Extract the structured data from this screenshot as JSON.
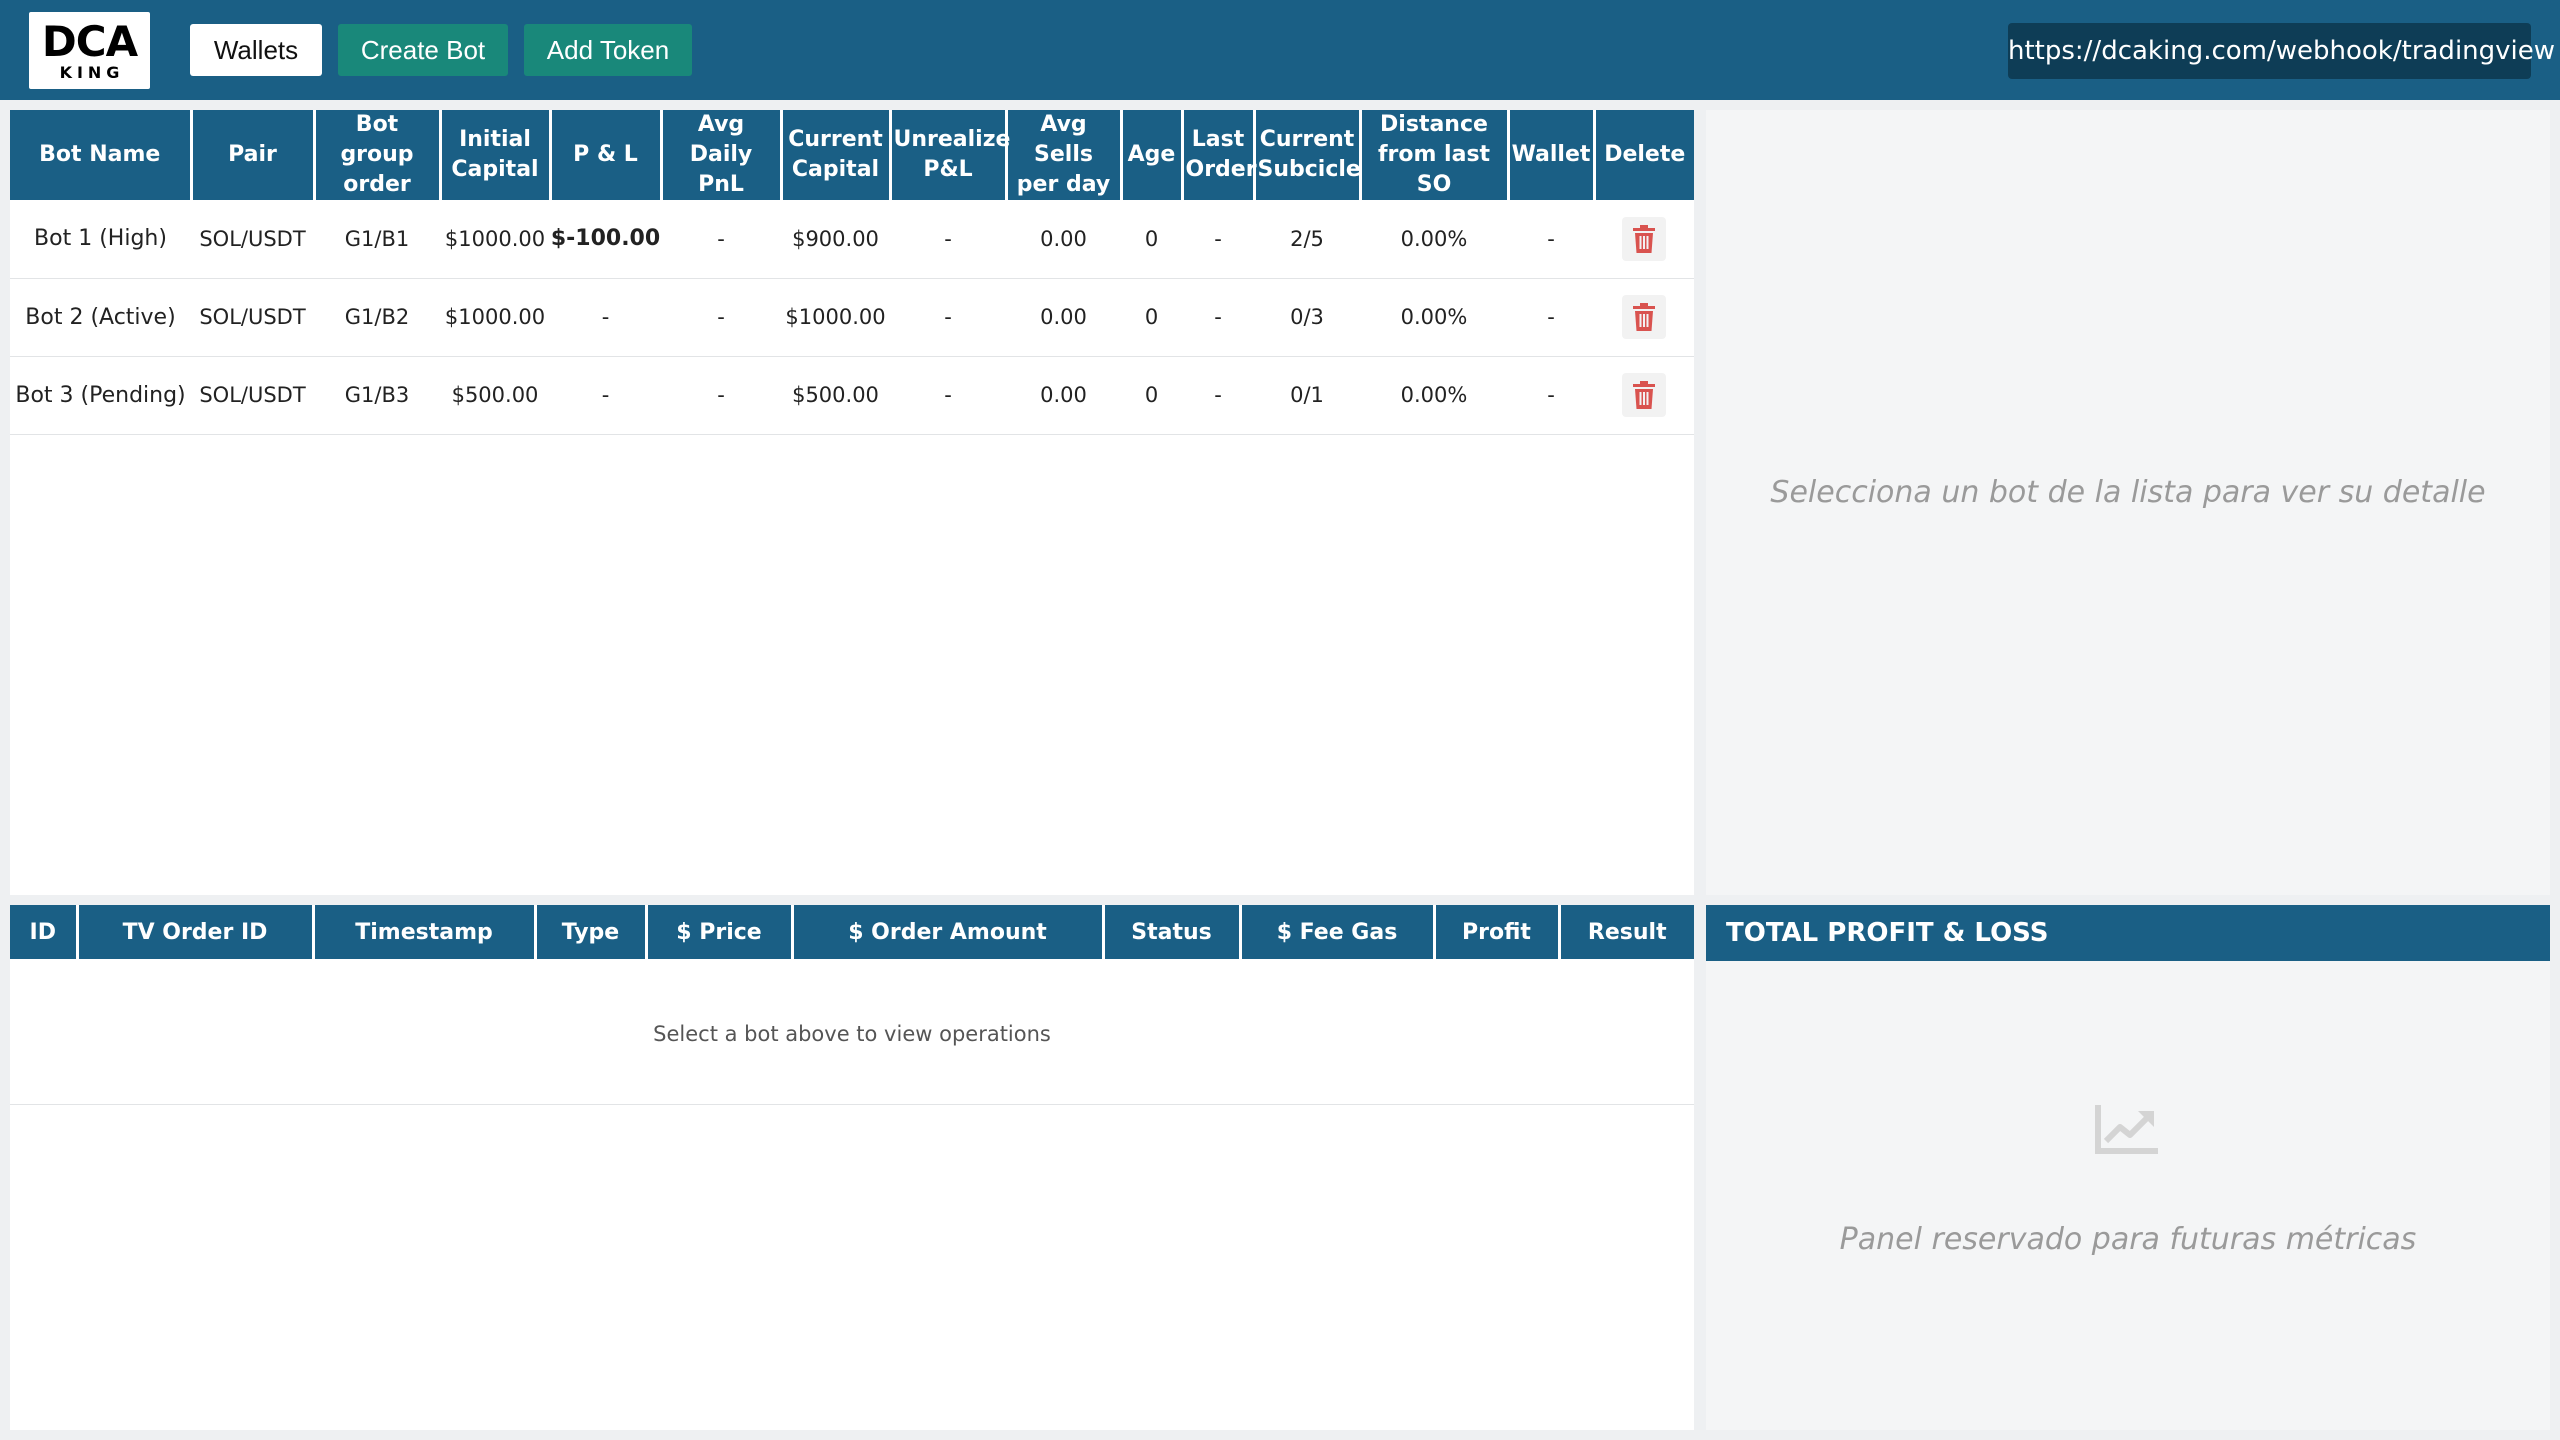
{
  "header": {
    "logo_main": "DCA",
    "logo_sub": "KING",
    "buttons": {
      "wallets": "Wallets",
      "create_bot": "Create Bot",
      "add_token": "Add Token"
    },
    "webhook_url": "https://dcaking.com/webhook/tradingview"
  },
  "bots": {
    "columns": [
      "Bot Name",
      "Pair",
      "Bot group order",
      "Initial Capital",
      "P & L",
      "Avg Daily PnL",
      "Current Capital",
      "Unrealize P&L",
      "Avg Sells per day",
      "Age",
      "Last Order",
      "Current Subcicle",
      "Distance from last SO",
      "Wallet",
      "Delete"
    ],
    "rows": [
      {
        "name": "Bot 1 (High)",
        "pair": "SOL/USDT",
        "group": "G1/B1",
        "initial": "$1000.00",
        "pnl": "$-100.00",
        "avg_daily": "-",
        "current": "$900.00",
        "unrealized": "-",
        "avg_sells": "0.00",
        "age": "0",
        "last_order": "-",
        "subcicle": "2/5",
        "distance": "0.00%",
        "wallet": "-"
      },
      {
        "name": "Bot 2 (Active)",
        "pair": "SOL/USDT",
        "group": "G1/B2",
        "initial": "$1000.00",
        "pnl": "-",
        "avg_daily": "-",
        "current": "$1000.00",
        "unrealized": "-",
        "avg_sells": "0.00",
        "age": "0",
        "last_order": "-",
        "subcicle": "0/3",
        "distance": "0.00%",
        "wallet": "-"
      },
      {
        "name": "Bot 3 (Pending)",
        "pair": "SOL/USDT",
        "group": "G1/B3",
        "initial": "$500.00",
        "pnl": "-",
        "avg_daily": "-",
        "current": "$500.00",
        "unrealized": "-",
        "avg_sells": "0.00",
        "age": "0",
        "last_order": "-",
        "subcicle": "0/1",
        "distance": "0.00%",
        "wallet": "-"
      }
    ]
  },
  "detail": {
    "message": "Selecciona un bot de la lista para ver su detalle"
  },
  "operations": {
    "columns": [
      "ID",
      "TV Order ID",
      "Timestamp",
      "Type",
      "$ Price",
      "$ Order Amount",
      "Status",
      "$ Fee Gas",
      "Profit",
      "Result"
    ],
    "empty_message": "Select a bot above to view operations"
  },
  "pnl_panel": {
    "title": "TOTAL PROFIT & LOSS",
    "icon": "chart-line-icon",
    "message": "Panel reservado para futuras métricas"
  },
  "colors": {
    "primary": "#1a5f85",
    "accent": "#19887a",
    "webhook_bg": "#0e3d56",
    "danger": "#d9534f"
  }
}
